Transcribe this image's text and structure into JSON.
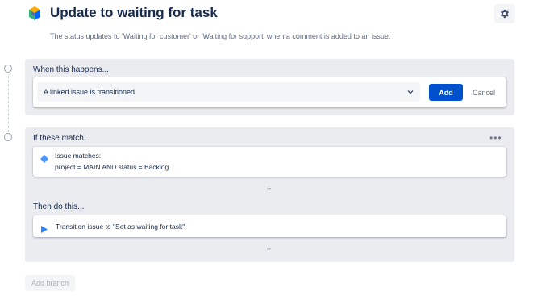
{
  "header": {
    "title": "Update to waiting for task",
    "description": "The status updates to 'Waiting for customer' or 'Waiting for support' when a comment is added to an issue.",
    "settings_icon": "gear-icon",
    "logo_icon": "automation-logo-icon"
  },
  "trigger": {
    "section_label": "When this happens...",
    "selected_value": "A linked issue is transitioned",
    "add_label": "Add",
    "cancel_label": "Cancel"
  },
  "conditions": {
    "section_label": "If these match...",
    "more_label": "•••",
    "items": [
      {
        "title": "Issue matches:",
        "detail": "project = MAIN AND status = Backlog",
        "icon": "diamond-icon"
      }
    ],
    "add_symbol": "+"
  },
  "actions": {
    "section_label": "Then do this...",
    "items": [
      {
        "title": "Transition issue to \"Set as waiting for task\"",
        "icon": "play-icon"
      }
    ],
    "add_symbol": "+"
  },
  "footer": {
    "add_branch_label": "Add branch"
  },
  "colors": {
    "primary": "#0052cc",
    "panel": "#ebecf0",
    "text": "#172b4d",
    "subtle_text": "#5e6c84"
  }
}
